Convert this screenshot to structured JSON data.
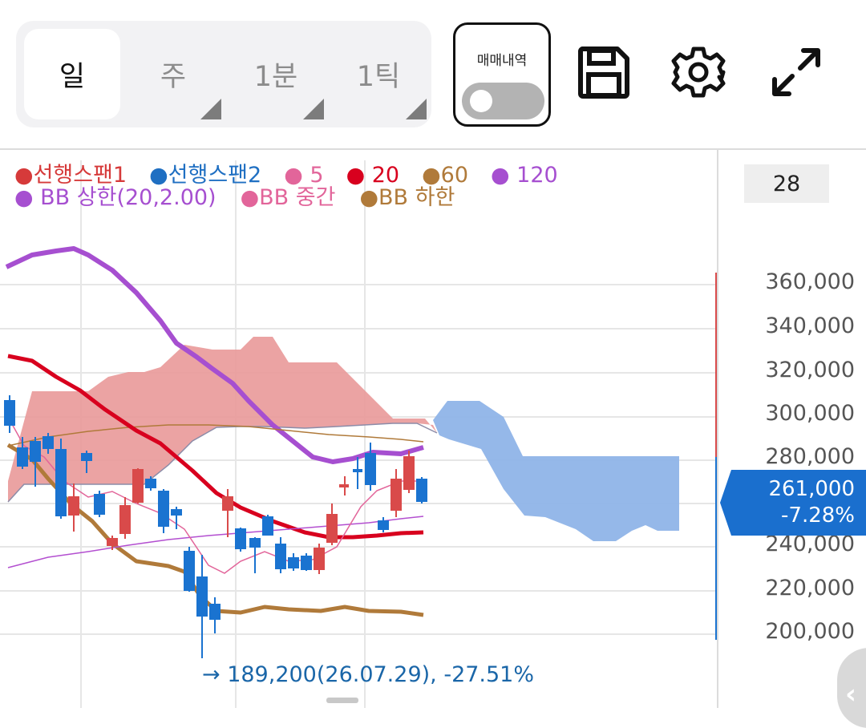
{
  "toolbar": {
    "tabs": [
      {
        "label": "일",
        "active": true
      },
      {
        "label": "주",
        "active": false
      },
      {
        "label": "1분",
        "active": false
      },
      {
        "label": "1틱",
        "active": false
      }
    ],
    "trade_history_label": "매매내역",
    "trade_history_on": false
  },
  "icons": {
    "save": "floppy-disk-icon",
    "settings": "gear-icon",
    "fullscreen": "expand-icon",
    "side_collapse": "chevron-left-icon"
  },
  "legend": {
    "row1": [
      {
        "label": "선행스팬1",
        "color": "#d63a3a"
      },
      {
        "label": "선행스팬2",
        "color": "#1f6fc2"
      },
      {
        "label": "5",
        "color": "#e2659a"
      },
      {
        "label": "20",
        "color": "#d8001e"
      },
      {
        "label": "60",
        "color": "#b07a3a"
      },
      {
        "label": "120",
        "color": "#a64fd0"
      }
    ],
    "row2": [
      {
        "label": "BB 상한(20,2.00)",
        "color": "#a64fd0"
      },
      {
        "label": "BB 중간",
        "color": "#e2659a"
      },
      {
        "label": "BB 하한",
        "color": "#b07a3a"
      }
    ]
  },
  "period_count": "28",
  "y_axis_labels": [
    "360,000",
    "340,000",
    "320,000",
    "300,000",
    "280,000",
    "240,000",
    "220,000",
    "200,000"
  ],
  "current_price": {
    "price": "261,000",
    "change": "-7.28%"
  },
  "min_marker": "→ 189,200(26.07.29), -27.51%",
  "colors": {
    "up": "#d94a4a",
    "down": "#1a73d0",
    "cloud_bull": "#e99999",
    "cloud_bear": "#8fb4e8"
  }
}
